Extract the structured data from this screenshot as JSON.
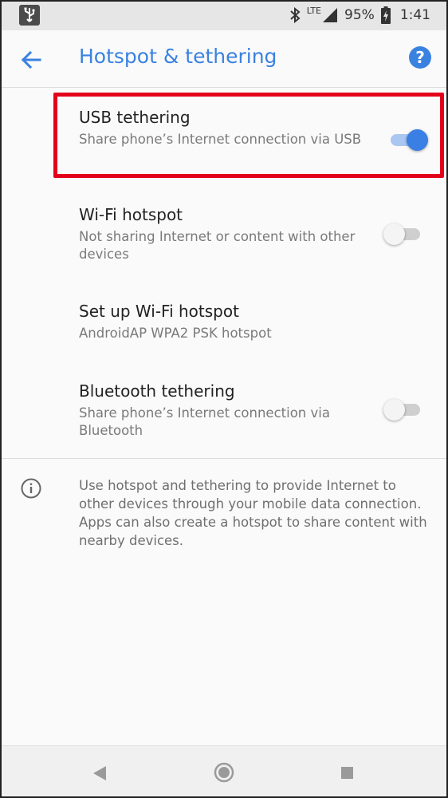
{
  "status_bar": {
    "network": "LTE",
    "battery": "95%",
    "time": "1:41",
    "icons": [
      "usb-icon",
      "bluetooth-icon",
      "signal-icon",
      "battery-icon"
    ]
  },
  "app_bar": {
    "title": "Hotspot & tethering",
    "back_icon": "arrow-back-icon",
    "help_icon": "help-icon"
  },
  "settings": [
    {
      "title": "USB tethering",
      "subtitle": "Share phone’s Internet connection via USB",
      "toggle": true,
      "enabled": true
    },
    {
      "title": "Wi-Fi hotspot",
      "subtitle": "Not sharing Internet or content with other devices",
      "toggle": true,
      "enabled": false
    },
    {
      "title": "Set up Wi-Fi hotspot",
      "subtitle": "AndroidAP WPA2 PSK hotspot",
      "toggle": false
    },
    {
      "title": "Bluetooth tethering",
      "subtitle": "Share phone’s Internet connection via Bluetooth",
      "toggle": true,
      "enabled": false
    }
  ],
  "info": {
    "icon": "info-icon",
    "text": "Use hotspot and tethering to provide Internet to other devices through your mobile data connection. Apps can also create a hotspot to share content with nearby devices."
  },
  "colors": {
    "accent": "#3a82e0",
    "highlight": "#e3001b"
  },
  "nav_bar": {
    "icons": [
      "nav-back-icon",
      "nav-home-icon",
      "nav-recents-icon"
    ]
  }
}
